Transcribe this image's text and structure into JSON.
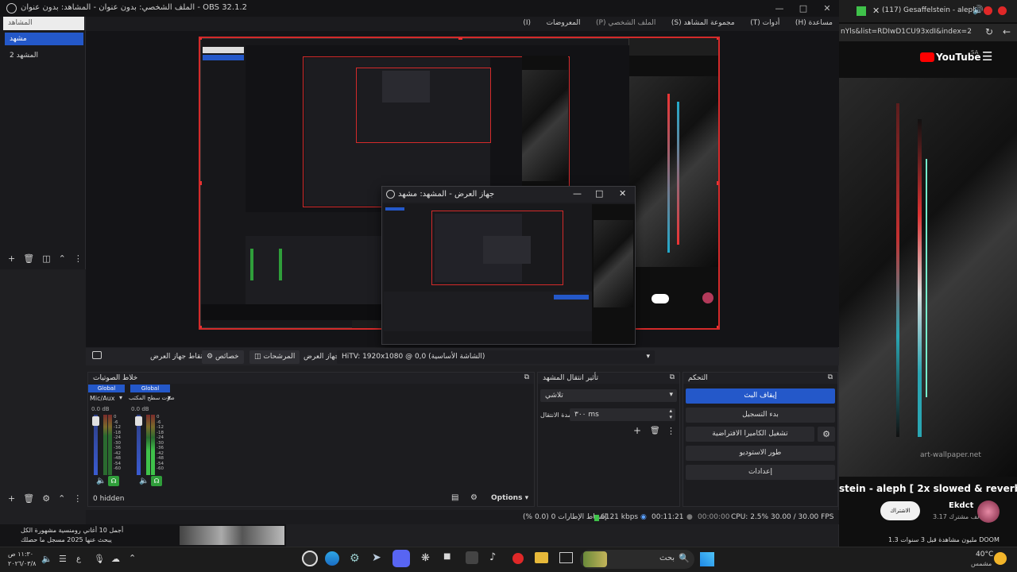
{
  "app": {
    "title": "الملف الشخصي: بدون عنوان - المشاهد: بدون عنوان - OBS 32.1.2",
    "menu": [
      "مساعدة (H)",
      "أدوات (T)",
      "مجموعة المشاهد (S)",
      "الملف الشخصي (P)",
      "المعروضات",
      "(I)"
    ]
  },
  "scenes": {
    "header": "المشاهد",
    "items": [
      "مشهد",
      "المشهد 2"
    ]
  },
  "projector": {
    "title": "جهاز العرض - المشهد: مشهد"
  },
  "toolbar": {
    "display_capture_label": "التقاط جهاز العرض",
    "properties_label": "خصائص",
    "filters_label": "المرشحات",
    "device_label": "جهاز العرض",
    "monitor_value": "HiTV: 1920x1080 @ 0,0 (الشاشة الأساسية)"
  },
  "audio": {
    "title": "خلاط الصوتيات",
    "channels": [
      {
        "badge": "Global",
        "name": "Mic/Aux",
        "db": "0.0 dB"
      },
      {
        "badge": "Global",
        "name": "صوت سطح المكتب",
        "db": "0.0 dB"
      }
    ],
    "scale": [
      "0",
      "-6",
      "-12",
      "-18",
      "-24",
      "-30",
      "-36",
      "-42",
      "-48",
      "-54",
      "-60"
    ],
    "hidden_label": "0 hidden"
  },
  "transitions": {
    "title": "تأثير انتقال المشهد",
    "selected": "تلاشي",
    "duration_label": "مدة الانتقال",
    "duration_value": "٣٠٠ ms"
  },
  "controls": {
    "title": "التحكم",
    "buttons": [
      "إيقاف البث",
      "بدء التسجيل",
      "تشغيل الكاميرا الافتراضية",
      "طور الاستوديو",
      "إعدادات"
    ]
  },
  "options_label": "Options",
  "status": {
    "dropped": "إسقاط الإطارات 0 (0.0 %)",
    "kbps": "6121 kbps",
    "stream_time": "00:11:21",
    "rec_time": "00:00:00",
    "cpu": "CPU: 2.5%",
    "fps": "30.00 / 30.00 FPS"
  },
  "youtube": {
    "tab_title": "(117) Gesaffelstein - aleph | 2",
    "address": "nYls&list=RDIwD1CU93xdI&index=2",
    "logo_text": "YouTube",
    "region": "SA",
    "video_title": "stein - aleph [ 2x slowed & reverb ]",
    "channel": "Ekdct",
    "subscribers": "3.17 ألف مشترك",
    "subscribe_label": "الاشتراك",
    "views": "1.3 مليون مشاهدة قبل 3 سنوات  DOOM",
    "watermark": "art-wallpaper.net"
  },
  "taskbar": {
    "time": "١١:٣٠ ص",
    "date": "٢٠٢٦/٠٣/٨",
    "search_placeholder": "بحث",
    "weather_temp": "40°C",
    "weather_desc": "مشمس",
    "news_line1": "أجمل 10 أغاني رومنسية مشهورة الكل",
    "news_line2": "يبحث عنها 2025 مسجل ما حصلك"
  },
  "colors": {
    "accent": "#2458c9",
    "selection_red": "#d42a2a",
    "youtube_red": "#ff0000"
  }
}
